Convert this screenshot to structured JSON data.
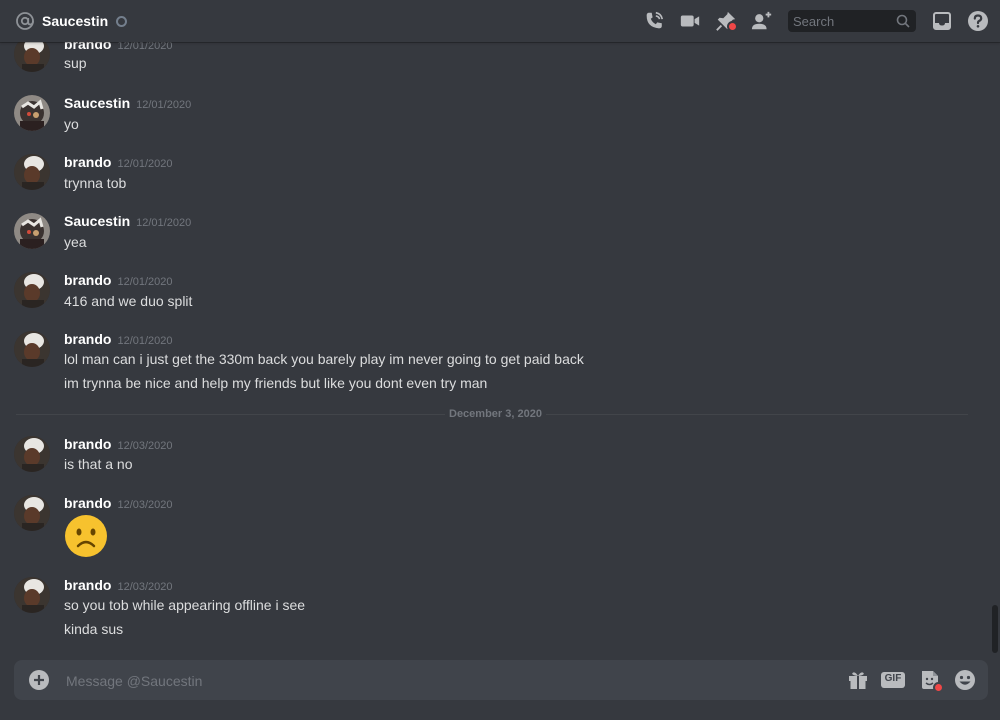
{
  "header": {
    "dm_name": "Saucestin",
    "search_placeholder": "Search",
    "icons": [
      "at-icon",
      "call-icon",
      "video-icon",
      "pin-icon",
      "add-friend-icon",
      "search-icon",
      "inbox-icon",
      "help-icon"
    ]
  },
  "date_separator": "December 3, 2020",
  "messages": [
    {
      "user": "brando",
      "ts": "12/01/2020",
      "lines": [
        "sup"
      ]
    },
    {
      "user": "Saucestin",
      "ts": "12/01/2020",
      "lines": [
        "yo"
      ]
    },
    {
      "user": "brando",
      "ts": "12/01/2020",
      "lines": [
        "trynna tob"
      ]
    },
    {
      "user": "Saucestin",
      "ts": "12/01/2020",
      "lines": [
        "yea"
      ]
    },
    {
      "user": "brando",
      "ts": "12/01/2020",
      "lines": [
        "416 and we duo split"
      ]
    },
    {
      "user": "brando",
      "ts": "12/01/2020",
      "lines": [
        "lol man can i just get the 330m back you barely play im never going to get paid back",
        "im trynna be nice and help my friends but like you dont even try man"
      ]
    },
    {
      "user": "brando",
      "ts": "12/03/2020",
      "lines": [
        "is that a no"
      ]
    },
    {
      "user": "brando",
      "ts": "12/03/2020",
      "emoji": "frowning-face-emoji"
    },
    {
      "user": "brando",
      "ts": "12/03/2020",
      "lines": [
        "so you tob while appearing offline i see",
        "kinda sus"
      ]
    }
  ],
  "composer": {
    "placeholder": "Message @Saucestin",
    "gif_label": "GIF"
  },
  "colors": {
    "background": "#36393f",
    "header": "#36393f",
    "composer": "#40444b",
    "search": "#202225",
    "accent_red": "#f04747",
    "emoji": "#f7c22e"
  }
}
